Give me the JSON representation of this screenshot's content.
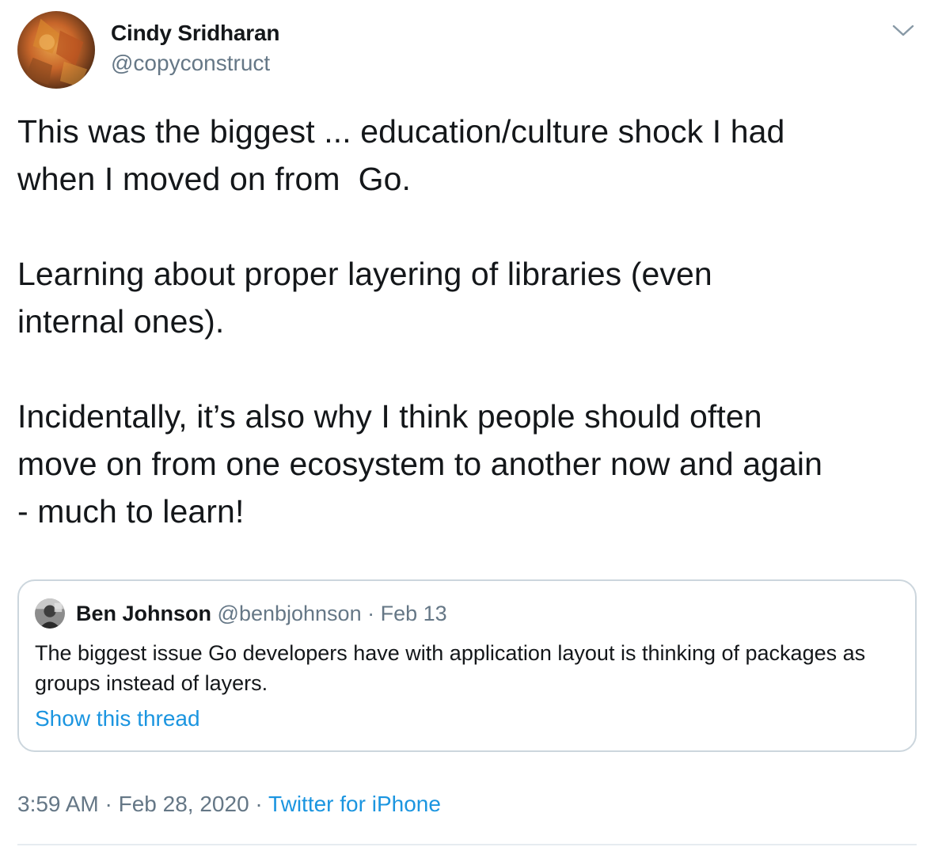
{
  "tweet": {
    "author": {
      "display_name": "Cindy Sridharan",
      "handle": "@copyconstruct"
    },
    "body_text": "This was the biggest ... education/culture shock I had\nwhen I moved on from  Go.\n\nLearning about proper layering of libraries (even\ninternal ones).\n\nIncidentally, it’s also why I think people should often\nmove on from one ecosystem to another now and again\n- much to learn!",
    "quoted": {
      "display_name": "Ben Johnson",
      "handle": "@benbjohnson",
      "separator": " · ",
      "date": "Feb 13",
      "text": "The biggest issue Go developers have with application layout is thinking of packages as groups instead of layers.",
      "show_thread_label": "Show this thread"
    },
    "meta": {
      "time": "3:59 AM",
      "separator": " · ",
      "date": "Feb 28, 2020",
      "source": "Twitter for iPhone"
    }
  },
  "icons": {
    "menu": "chevron-down-icon",
    "author_avatar": "avatar-autumn-leaves",
    "quoted_avatar": "avatar-photo"
  },
  "colors": {
    "text_primary": "#14171a",
    "text_secondary": "#657786",
    "link": "#1b95e0",
    "border": "#ccd6dd",
    "divider": "#e6ecf0"
  }
}
